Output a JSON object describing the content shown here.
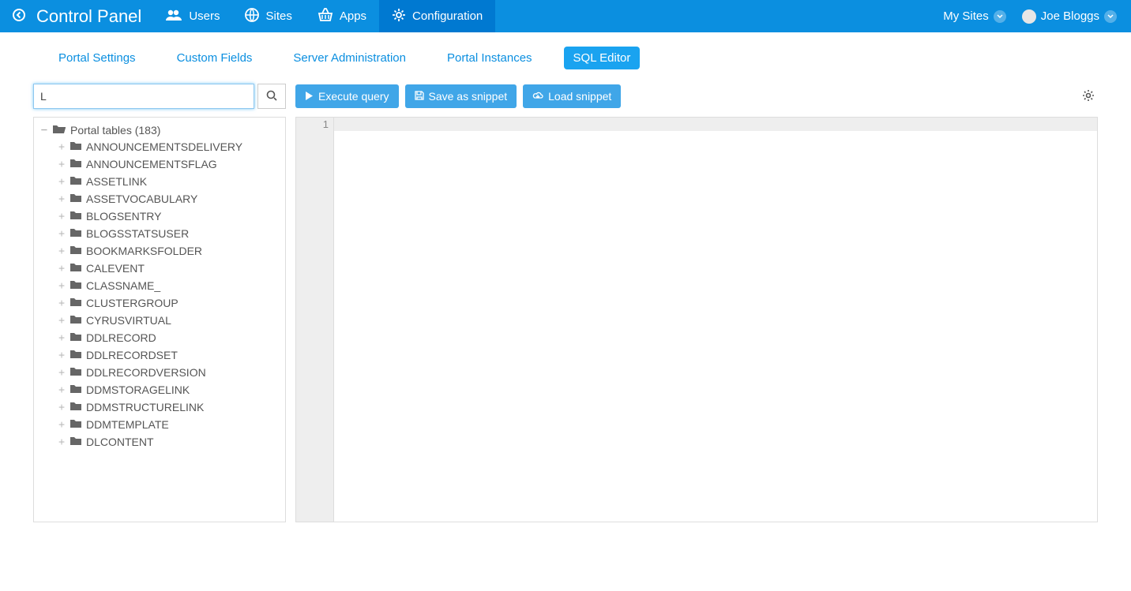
{
  "topbar": {
    "title": "Control Panel",
    "nav": [
      {
        "label": "Users"
      },
      {
        "label": "Sites"
      },
      {
        "label": "Apps"
      },
      {
        "label": "Configuration",
        "active": true
      }
    ],
    "mysites": "My Sites",
    "user": "Joe Bloggs"
  },
  "subtabs": [
    {
      "label": "Portal Settings"
    },
    {
      "label": "Custom Fields"
    },
    {
      "label": "Server Administration"
    },
    {
      "label": "Portal Instances"
    },
    {
      "label": "SQL Editor",
      "active": true
    }
  ],
  "search": {
    "value": "L"
  },
  "tree": {
    "root_label": "Portal tables (183)",
    "items": [
      "ANNOUNCEMENTSDELIVERY",
      "ANNOUNCEMENTSFLAG",
      "ASSETLINK",
      "ASSETVOCABULARY",
      "BLOGSENTRY",
      "BLOGSSTATSUSER",
      "BOOKMARKSFOLDER",
      "CALEVENT",
      "CLASSNAME_",
      "CLUSTERGROUP",
      "CYRUSVIRTUAL",
      "DDLRECORD",
      "DDLRECORDSET",
      "DDLRECORDVERSION",
      "DDMSTORAGELINK",
      "DDMSTRUCTURELINK",
      "DDMTEMPLATE",
      "DLCONTENT"
    ]
  },
  "toolbar": {
    "execute": "Execute query",
    "save": "Save as snippet",
    "load": "Load snippet"
  },
  "editor": {
    "line": "1"
  }
}
